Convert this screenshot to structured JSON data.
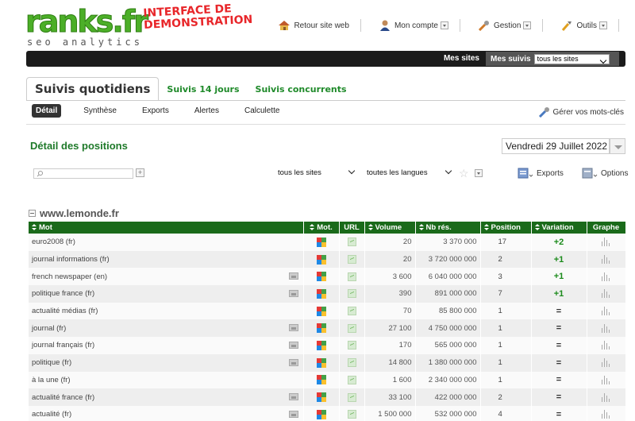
{
  "header": {
    "logo_text": "ranks.fr",
    "logo_tagline": "seo analytics",
    "demo_line1": "INTERFACE DE",
    "demo_line2": "DEMONSTRATION",
    "nav": [
      {
        "label": "Retour site web",
        "icon": "home-icon"
      },
      {
        "label": "Mon compte",
        "icon": "user-icon"
      },
      {
        "label": "Gestion",
        "icon": "wrench-icon"
      },
      {
        "label": "Outils",
        "icon": "tools-icon"
      }
    ]
  },
  "blackbar": {
    "mes_sites": "Mes sites",
    "mes_suivis": "Mes suivis",
    "site_select": "tous les sites"
  },
  "tabs": {
    "active": "Suivis quotidiens",
    "items": [
      "Suivis 14 jours",
      "Suivis concurrents"
    ]
  },
  "subtabs": {
    "active": "Détail",
    "items": [
      "Synthèse",
      "Exports",
      "Alertes",
      "Calculette"
    ],
    "manage": "Gérer vos mots-clés"
  },
  "page": {
    "title": "Détail des positions",
    "date": "Vendredi 29 Juillet 2022"
  },
  "filters": {
    "sites": "tous les sites",
    "langs": "toutes les langues",
    "exports": "Exports",
    "options": "Options"
  },
  "section": {
    "title": "www.lemonde.fr"
  },
  "table": {
    "headers": [
      "Mot",
      "Mot.",
      "URL",
      "Volume",
      "Nb rés.",
      "Position",
      "Variation",
      "Graphe"
    ],
    "rows": [
      {
        "mot": "euro2008 (fr)",
        "img": false,
        "volume": "20",
        "nb": "3 370 000",
        "pos": "17",
        "var": "+2"
      },
      {
        "mot": "journal informations (fr)",
        "img": false,
        "volume": "20",
        "nb": "3 720 000 000",
        "pos": "2",
        "var": "+1"
      },
      {
        "mot": "french newspaper (en)",
        "img": true,
        "volume": "3 600",
        "nb": "6 040 000 000",
        "pos": "3",
        "var": "+1"
      },
      {
        "mot": "politique france (fr)",
        "img": true,
        "volume": "390",
        "nb": "891 000 000",
        "pos": "7",
        "var": "+1"
      },
      {
        "mot": "actualité médias (fr)",
        "img": false,
        "volume": "70",
        "nb": "85 800 000",
        "pos": "1",
        "var": "="
      },
      {
        "mot": "journal (fr)",
        "img": true,
        "volume": "27 100",
        "nb": "4 750 000 000",
        "pos": "1",
        "var": "="
      },
      {
        "mot": "journal français (fr)",
        "img": true,
        "volume": "170",
        "nb": "565 000 000",
        "pos": "1",
        "var": "="
      },
      {
        "mot": "politique (fr)",
        "img": true,
        "volume": "14 800",
        "nb": "1 380 000 000",
        "pos": "1",
        "var": "="
      },
      {
        "mot": "à la une (fr)",
        "img": false,
        "volume": "1 600",
        "nb": "2 340 000 000",
        "pos": "1",
        "var": "="
      },
      {
        "mot": "actualité france (fr)",
        "img": true,
        "volume": "33 100",
        "nb": "422 000 000",
        "pos": "2",
        "var": "="
      },
      {
        "mot": "actualité (fr)",
        "img": true,
        "volume": "1 500 000",
        "nb": "532 000 000",
        "pos": "4",
        "var": "="
      }
    ]
  },
  "colors": {
    "brand_green": "#4caf28",
    "header_green": "#1a6a1a",
    "title_green": "#1f7a2a",
    "demo_red": "#e8262a"
  }
}
